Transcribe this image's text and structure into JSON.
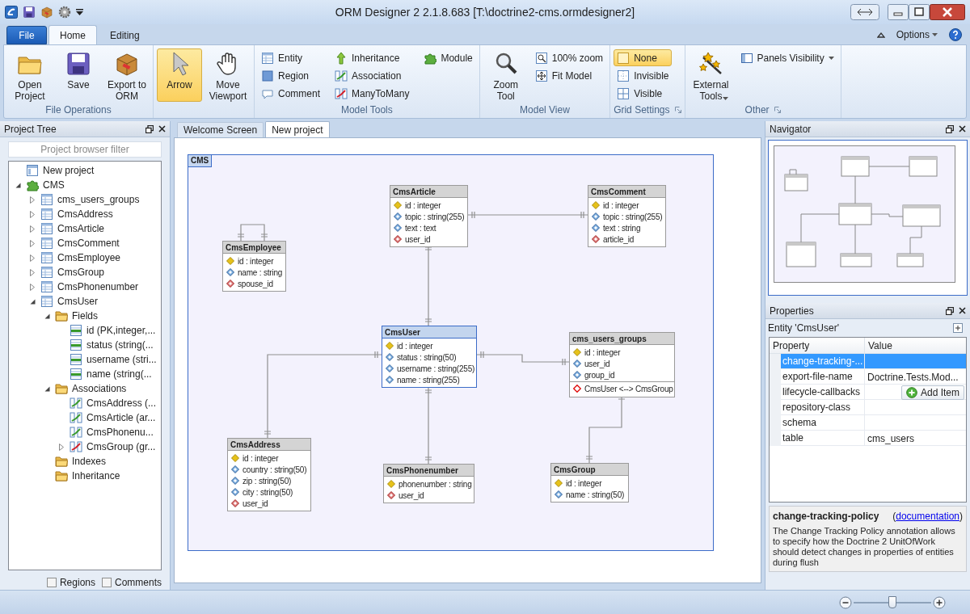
{
  "window": {
    "title": "ORM Designer 2 2.1.8.683 [T:\\doctrine2-cms.ormdesigner2]"
  },
  "ribbon": {
    "tabs": [
      {
        "label": "File",
        "kind": "file",
        "selected": false
      },
      {
        "label": "Home",
        "kind": "tab",
        "selected": true
      },
      {
        "label": "Editing",
        "kind": "tab",
        "selected": false
      }
    ],
    "options": "Options",
    "groups": [
      {
        "label": "File Operations",
        "buttons": [
          {
            "label": "Open Project",
            "kind": "large",
            "selected": false
          },
          {
            "label": "Save",
            "kind": "large",
            "selected": false
          },
          {
            "label": "Export to ORM",
            "kind": "large",
            "selected": false
          }
        ]
      },
      {
        "buttons": [
          {
            "label": "Arrow",
            "kind": "large",
            "selected": true
          },
          {
            "label": "Move Viewport",
            "kind": "large",
            "selected": false
          }
        ]
      },
      {
        "label": "Model Tools",
        "buttons": [
          {
            "label": "Entity",
            "kind": "small",
            "selected": false
          },
          {
            "label": "Region",
            "kind": "small",
            "selected": false
          },
          {
            "label": "Comment",
            "kind": "small",
            "selected": false
          },
          {
            "label": "Inheritance",
            "kind": "small",
            "selected": false
          },
          {
            "label": "Association",
            "kind": "small",
            "selected": false
          },
          {
            "label": "ManyToMany",
            "kind": "small",
            "selected": false
          },
          {
            "label": "Module",
            "kind": "small",
            "selected": false
          }
        ]
      },
      {
        "label": "Model View",
        "buttons": [
          {
            "label": "Zoom Tool",
            "kind": "large",
            "selected": false
          },
          {
            "label": "100% zoom",
            "kind": "small",
            "selected": false
          },
          {
            "label": "Fit Model",
            "kind": "small",
            "selected": false
          }
        ]
      },
      {
        "label": "Grid Settings",
        "launcher": true,
        "buttons": [
          {
            "label": "None",
            "kind": "small",
            "selected": true
          },
          {
            "label": "Invisible",
            "kind": "small",
            "selected": false
          },
          {
            "label": "Visible",
            "kind": "small",
            "selected": false
          }
        ]
      },
      {
        "label": "Other",
        "launcher": true,
        "buttons": [
          {
            "label": "External Tools",
            "kind": "large",
            "selected": false,
            "dropdown": true
          },
          {
            "label": "Panels Visibility",
            "kind": "small",
            "selected": false,
            "dropdown": true
          }
        ]
      }
    ]
  },
  "project_tree": {
    "title": "Project Tree",
    "filter_placeholder": "Project browser filter",
    "tree": [
      {
        "label": "New project",
        "kind": "project"
      },
      {
        "label": "CMS",
        "kind": "module",
        "expanded": true,
        "children": [
          {
            "label": "cms_users_groups",
            "kind": "entity",
            "expanded": false
          },
          {
            "label": "CmsAddress",
            "kind": "entity",
            "expanded": false
          },
          {
            "label": "CmsArticle",
            "kind": "entity",
            "expanded": false
          },
          {
            "label": "CmsComment",
            "kind": "entity",
            "expanded": false
          },
          {
            "label": "CmsEmployee",
            "kind": "entity",
            "expanded": false
          },
          {
            "label": "CmsGroup",
            "kind": "entity",
            "expanded": false
          },
          {
            "label": "CmsPhonenumber",
            "kind": "entity",
            "expanded": false
          },
          {
            "label": "CmsUser",
            "kind": "entity",
            "expanded": true,
            "children": [
              {
                "label": "Fields",
                "kind": "folder",
                "expanded": true,
                "children": [
                  {
                    "label": "id (PK,integer,...",
                    "kind": "field"
                  },
                  {
                    "label": "status (string(...",
                    "kind": "field"
                  },
                  {
                    "label": "username (stri...",
                    "kind": "field"
                  },
                  {
                    "label": "name (string(...",
                    "kind": "field"
                  }
                ]
              },
              {
                "label": "Associations",
                "kind": "folder",
                "expanded": true,
                "children": [
                  {
                    "label": "CmsAddress (...",
                    "kind": "association"
                  },
                  {
                    "label": "CmsArticle (ar...",
                    "kind": "association"
                  },
                  {
                    "label": "CmsPhonenu...",
                    "kind": "association"
                  },
                  {
                    "label": "CmsGroup (gr...",
                    "kind": "manytomany",
                    "expanded": false
                  }
                ]
              },
              {
                "label": "Indexes",
                "kind": "folder"
              },
              {
                "label": "Inheritance",
                "kind": "folder"
              }
            ]
          }
        ]
      }
    ],
    "checkboxes": [
      {
        "label": "Regions",
        "checked": false
      },
      {
        "label": "Comments",
        "checked": false
      }
    ]
  },
  "document_tabs": [
    {
      "label": "Welcome Screen",
      "selected": false
    },
    {
      "label": "New project",
      "selected": true
    }
  ],
  "diagram": {
    "region": "CMS",
    "entities": [
      {
        "name": "CmsArticle",
        "selected": false,
        "fields": [
          {
            "text": "id : integer",
            "kind": "pk"
          },
          {
            "text": "topic : string(255)",
            "kind": "field"
          },
          {
            "text": "text : text",
            "kind": "field"
          },
          {
            "text": "user_id",
            "kind": "fk"
          }
        ]
      },
      {
        "name": "CmsComment",
        "selected": false,
        "fields": [
          {
            "text": "id : integer",
            "kind": "pk"
          },
          {
            "text": "topic : string(255)",
            "kind": "field"
          },
          {
            "text": "text : string",
            "kind": "field"
          },
          {
            "text": "article_id",
            "kind": "fk"
          }
        ]
      },
      {
        "name": "CmsEmployee",
        "selected": false,
        "fields": [
          {
            "text": "id : integer",
            "kind": "pk"
          },
          {
            "text": "name : string",
            "kind": "field"
          },
          {
            "text": "spouse_id",
            "kind": "fk"
          }
        ]
      },
      {
        "name": "CmsUser",
        "selected": true,
        "fields": [
          {
            "text": "id : integer",
            "kind": "pk"
          },
          {
            "text": "status : string(50)",
            "kind": "field"
          },
          {
            "text": "username : string(255)",
            "kind": "field"
          },
          {
            "text": "name : string(255)",
            "kind": "field"
          }
        ]
      },
      {
        "name": "cms_users_groups",
        "selected": false,
        "fields": [
          {
            "text": "id : integer",
            "kind": "pk"
          },
          {
            "text": "user_id",
            "kind": "field"
          },
          {
            "text": "group_id",
            "kind": "field"
          },
          {
            "text": "CmsUser <--> CmsGroup",
            "kind": "association"
          }
        ]
      },
      {
        "name": "CmsAddress",
        "selected": false,
        "fields": [
          {
            "text": "id : integer",
            "kind": "pk"
          },
          {
            "text": "country : string(50)",
            "kind": "field"
          },
          {
            "text": "zip : string(50)",
            "kind": "field"
          },
          {
            "text": "city : string(50)",
            "kind": "field"
          },
          {
            "text": "user_id",
            "kind": "fk"
          }
        ]
      },
      {
        "name": "CmsPhonenumber",
        "selected": false,
        "fields": [
          {
            "text": "phonenumber : string",
            "kind": "pk"
          },
          {
            "text": "user_id",
            "kind": "fk"
          }
        ]
      },
      {
        "name": "CmsGroup",
        "selected": false,
        "fields": [
          {
            "text": "id : integer",
            "kind": "pk"
          },
          {
            "text": "name : string(50)",
            "kind": "field"
          }
        ]
      }
    ]
  },
  "navigator": {
    "title": "Navigator"
  },
  "properties": {
    "title": "Properties",
    "subject": "Entity 'CmsUser'",
    "columns": [
      "Property",
      "Value"
    ],
    "rows": [
      {
        "name": "change-tracking-...",
        "kind": "text",
        "selected": true
      },
      {
        "name": "export-file-name",
        "kind": "text",
        "value": "Doctrine.Tests.Mod...",
        "selected": false
      },
      {
        "name": "lifecycle-callbacks",
        "kind": "button",
        "value": "Add Item",
        "selected": false
      },
      {
        "name": "repository-class",
        "kind": "text",
        "selected": false
      },
      {
        "name": "schema",
        "kind": "text",
        "selected": false
      },
      {
        "name": "table",
        "kind": "text",
        "value": "cms_users",
        "selected": false
      }
    ],
    "description": {
      "title": "change-tracking-policy",
      "link_open": "(",
      "link": "documentation",
      "link_close": ")",
      "text": "The Change Tracking Policy annotation allows to specify how the Doctrine 2 UnitOfWork should detect changes in properties of entities during flush"
    }
  },
  "status_bar": {
    "zoom": {
      "level": 0.5
    }
  }
}
